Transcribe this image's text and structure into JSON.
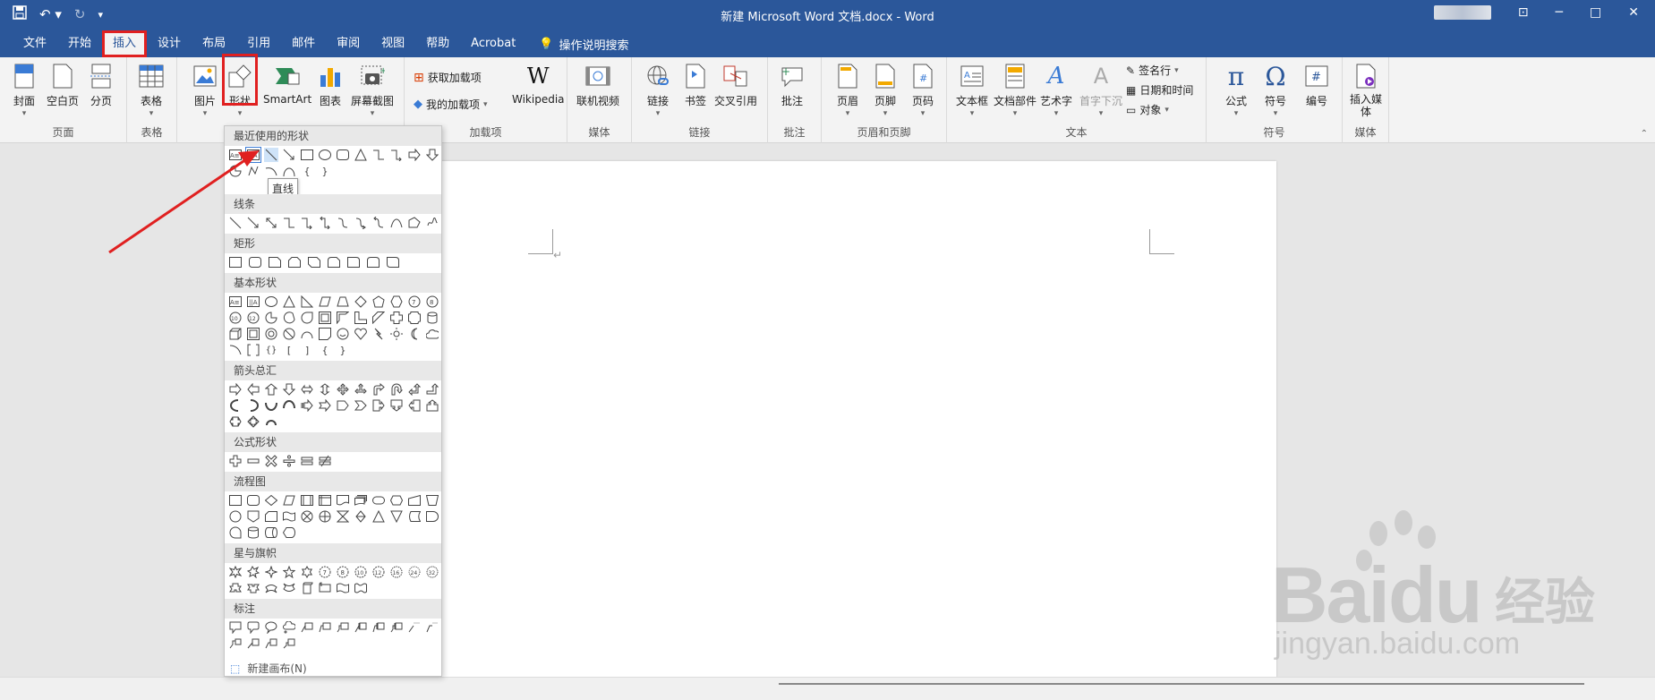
{
  "window": {
    "title": "新建 Microsoft Word 文档.docx - Word",
    "qat": {
      "save_icon": "save-icon",
      "undo_icon": "undo-icon",
      "redo_icon": "redo-icon",
      "customize_icon": "customize-icon"
    },
    "controls": [
      "─",
      "□",
      "✕"
    ]
  },
  "tabs": [
    "文件",
    "开始",
    "插入",
    "设计",
    "布局",
    "引用",
    "邮件",
    "审阅",
    "视图",
    "帮助",
    "Acrobat"
  ],
  "active_tab": "插入",
  "tell_me": "操作说明搜索",
  "ribbon": {
    "pages": {
      "label": "页面",
      "cover": "封面",
      "blank": "空白页",
      "break": "分页"
    },
    "tables": {
      "label": "表格",
      "table": "表格"
    },
    "illustrations": {
      "picture": "图片",
      "shapes": "形状",
      "smartart": "SmartArt",
      "chart": "图表",
      "screenshot": "屏幕截图"
    },
    "addins": {
      "label": "加载项",
      "get": "获取加载项",
      "my": "我的加载项",
      "wikipedia": "Wikipedia"
    },
    "media": {
      "label": "媒体",
      "video": "联机视频"
    },
    "links": {
      "label": "链接",
      "link": "链接",
      "bookmark": "书签",
      "crossref": "交叉引用"
    },
    "comments": {
      "label": "批注",
      "comment": "批注"
    },
    "header_footer": {
      "label": "页眉和页脚",
      "header": "页眉",
      "footer": "页脚",
      "page_number": "页码"
    },
    "text": {
      "label": "文本",
      "textbox": "文本框",
      "quickparts": "文档部件",
      "wordart": "艺术字",
      "dropcap": "首字下沉",
      "signature": "签名行",
      "datetime": "日期和时间",
      "object": "对象"
    },
    "symbols": {
      "label": "符号",
      "equation": "公式",
      "symbol": "符号",
      "number": "编号"
    },
    "media2": {
      "label": "媒体",
      "insert_media": "插入媒体"
    }
  },
  "shapes_menu": {
    "categories": [
      "最近使用的形状",
      "线条",
      "矩形",
      "基本形状",
      "箭头总汇",
      "公式形状",
      "流程图",
      "星与旗帜",
      "标注"
    ],
    "tooltip": "直线",
    "new_canvas": "新建画布(N)"
  },
  "document": {
    "paragraph_mark": "↵"
  },
  "watermark": {
    "brand": "Baidu",
    "cn": "经验",
    "url": "jingyan.baidu.com"
  },
  "colors": {
    "brand": "#2b579a",
    "highlight": "#e02020",
    "ribbon_bg": "#f3f3f3"
  }
}
